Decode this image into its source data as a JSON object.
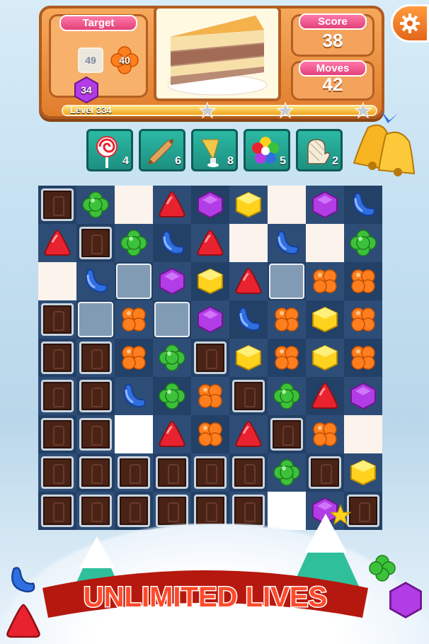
{
  "header": {
    "target_label": "Target",
    "score_label": "Score",
    "score_value": "38",
    "moves_label": "Moves",
    "moves_value": "42",
    "level_label": "Level 334",
    "targets": [
      {
        "icon": "ice-block-icon",
        "count": "49"
      },
      {
        "icon": "orange-flower-candy-icon",
        "count": "40"
      },
      {
        "icon": "purple-hexagon-candy-icon",
        "count": "34"
      }
    ],
    "level_progress": 1.0,
    "settings_icon": "gear-icon"
  },
  "boosters": [
    {
      "icon": "lollipop-icon",
      "count": "4"
    },
    {
      "icon": "rolling-pin-icon",
      "count": "6"
    },
    {
      "icon": "icing-bag-icon",
      "count": "8"
    },
    {
      "icon": "rainbow-flower-icon",
      "count": "5"
    },
    {
      "icon": "oven-mitt-icon",
      "count": "2"
    }
  ],
  "board": {
    "cols": 9,
    "rows": 9,
    "grid": [
      [
        "C",
        "G",
        "E",
        "R",
        "P",
        "Y",
        "E",
        "P",
        "B"
      ],
      [
        "R",
        "C",
        "G",
        "B",
        "R",
        "E",
        "B",
        "E",
        "G"
      ],
      [
        "E",
        "B",
        "I",
        "P",
        "Y",
        "R",
        "I",
        "O",
        "O"
      ],
      [
        "C",
        "I",
        "O",
        "I",
        "P",
        "B",
        "O",
        "Y",
        "O"
      ],
      [
        "C",
        "X",
        "O",
        "G",
        "C",
        "Y",
        "O",
        "Y",
        "O"
      ],
      [
        "C",
        "C",
        "B",
        "G",
        "O",
        "C",
        "G",
        "R",
        "P"
      ],
      [
        "C",
        "C",
        "W",
        "R",
        "O",
        "R",
        "C",
        "O",
        "E"
      ],
      [
        "C",
        "C",
        "C",
        "C",
        "C",
        "C",
        "G",
        "C",
        "Y"
      ],
      [
        "C",
        "C",
        "C",
        "C",
        "C",
        "C",
        "W",
        "P",
        "C"
      ]
    ],
    "colors": {
      "red": "#e8232f",
      "green": "#3cc23a",
      "blue": "#2f6fe0",
      "purple": "#b23ce6",
      "yellow": "#ffd21e",
      "orange": "#ff7f1e"
    }
  },
  "banner": {
    "text": "UNLIMITED LIVES"
  }
}
